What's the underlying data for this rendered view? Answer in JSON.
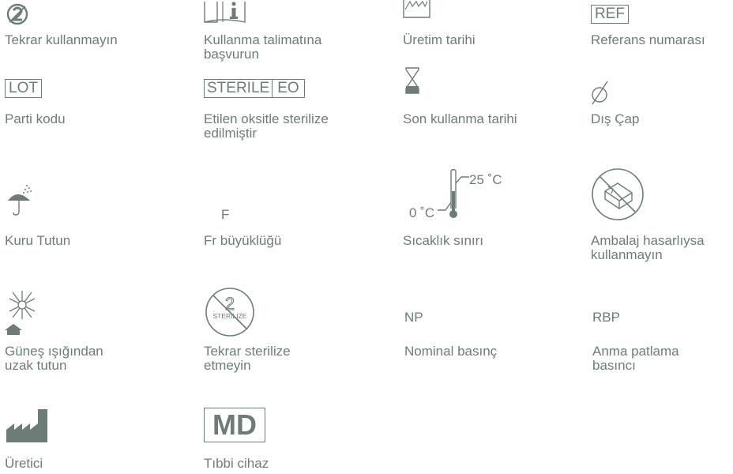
{
  "colors": {
    "ink": "#6e7c77",
    "background": "#ffffff"
  },
  "rows": [
    [
      {
        "icon": "do-not-reuse-icon",
        "label": "Tekrar kullanmayın"
      },
      {
        "icon": "consult-instructions-icon",
        "label": "Kullanma talimatına başvurun"
      },
      {
        "icon": "manufacture-date-icon",
        "label": "Üretim tarihi"
      },
      {
        "icon": "ref-box-icon",
        "symbol_text": "REF",
        "label": "Referans numarası"
      }
    ],
    [
      {
        "icon": "lot-box-icon",
        "symbol_text": "LOT",
        "label": "Parti kodu"
      },
      {
        "icon": "sterile-eo-icon",
        "symbol_text": [
          "STERILE",
          "EO"
        ],
        "label": "Etilen oksitle sterilize edilmiştir"
      },
      {
        "icon": "hourglass-icon",
        "label": "Son kullanma tarihi"
      },
      {
        "icon": "diameter-icon",
        "label": "Dış Çap"
      }
    ],
    [
      {
        "icon": "umbrella-icon",
        "label": "Kuru Tutun"
      },
      {
        "icon": "french-size-icon",
        "symbol_text": "F",
        "label": "Fr büyüklüğü"
      },
      {
        "icon": "thermometer-icon",
        "symbol_text": [
          "25 ˚C",
          "0 ˚C"
        ],
        "label": "Sıcaklık sınırı"
      },
      {
        "icon": "damaged-package-icon",
        "label": "Ambalaj hasarlıysa kullanmayın"
      }
    ],
    [
      {
        "icon": "sun-house-icon",
        "label": "Güneş ışığından uzak tutun"
      },
      {
        "icon": "do-not-resterilize-icon",
        "symbol_text": [
          "2",
          "STERILIZE"
        ],
        "label": "Tekrar sterilize etmeyin"
      },
      {
        "icon": "np-text-icon",
        "symbol_text": "NP",
        "label": "Nominal basınç"
      },
      {
        "icon": "rbp-text-icon",
        "symbol_text": "RBP",
        "label": "Anma patlama basıncı"
      }
    ],
    [
      {
        "icon": "factory-icon",
        "label": "Üretici"
      },
      {
        "icon": "md-box-icon",
        "symbol_text": "MD",
        "label": "Tıbbi cihaz"
      }
    ]
  ]
}
